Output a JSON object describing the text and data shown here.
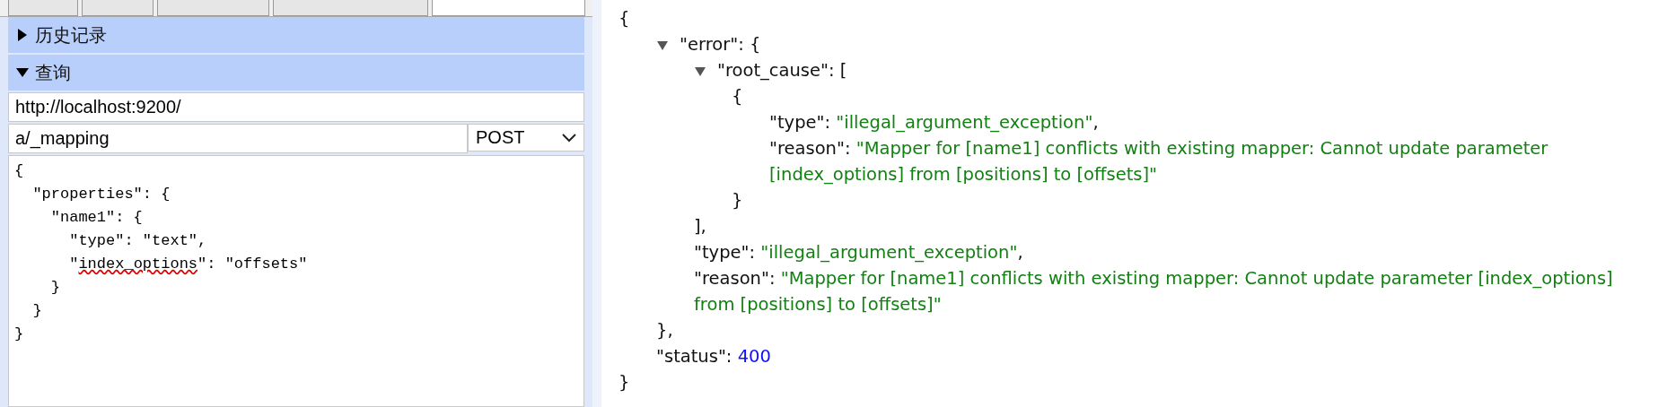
{
  "top_tabs": [
    {
      "selected": false
    },
    {
      "selected": false
    },
    {
      "selected": false
    },
    {
      "selected": false
    },
    {
      "selected": true
    }
  ],
  "sections": [
    {
      "title": "历史记录",
      "expanded": false
    },
    {
      "title": "查询",
      "expanded": true
    }
  ],
  "query": {
    "url": "http://localhost:9200/",
    "path": "a/_mapping",
    "method": "POST",
    "body": [
      [
        {
          "t": "{",
          "misspelled": false
        }
      ],
      [
        {
          "t": "  \"properties\": {",
          "misspelled": false
        }
      ],
      [
        {
          "t": "    \"name1\": {",
          "misspelled": false
        }
      ],
      [
        {
          "t": "      \"type\": \"text\",",
          "misspelled": false
        }
      ],
      [
        {
          "t": "      \"",
          "misspelled": false
        },
        {
          "t": "index_options",
          "misspelled": true
        },
        {
          "t": "\": \"offsets\"",
          "misspelled": false
        }
      ],
      [
        {
          "t": "    }",
          "misspelled": false
        }
      ],
      [
        {
          "t": "  }",
          "misspelled": false
        }
      ],
      [
        {
          "t": "}",
          "misspelled": false
        }
      ]
    ]
  },
  "response": {
    "open": "{",
    "close": "}",
    "children": [
      {
        "kind": "node",
        "key": "\"error\": ",
        "open": "{",
        "expanded": true,
        "close": "},",
        "children": [
          {
            "kind": "node",
            "key": "\"root_cause\": ",
            "open": "[",
            "expanded": true,
            "close": "],",
            "children": [
              {
                "kind": "node",
                "open": "{",
                "close": "}",
                "children": [
                  {
                    "kind": "string",
                    "key": "\"type\": ",
                    "value": "\"illegal_argument_exception\"",
                    "trail": ","
                  },
                  {
                    "kind": "string",
                    "key": "\"reason\": ",
                    "value": "\"Mapper for [name1] conflicts with existing mapper: Cannot update parameter [index_options] from [positions] to [offsets]\""
                  }
                ]
              }
            ]
          },
          {
            "kind": "string",
            "key": "\"type\": ",
            "value": "\"illegal_argument_exception\"",
            "trail": ","
          },
          {
            "kind": "string",
            "key": "\"reason\": ",
            "value": "\"Mapper for [name1] conflicts with existing mapper: Cannot update parameter [index_options] from [positions] to [offsets]\""
          }
        ]
      },
      {
        "kind": "number",
        "key": "\"status\": ",
        "value": "400"
      }
    ]
  }
}
